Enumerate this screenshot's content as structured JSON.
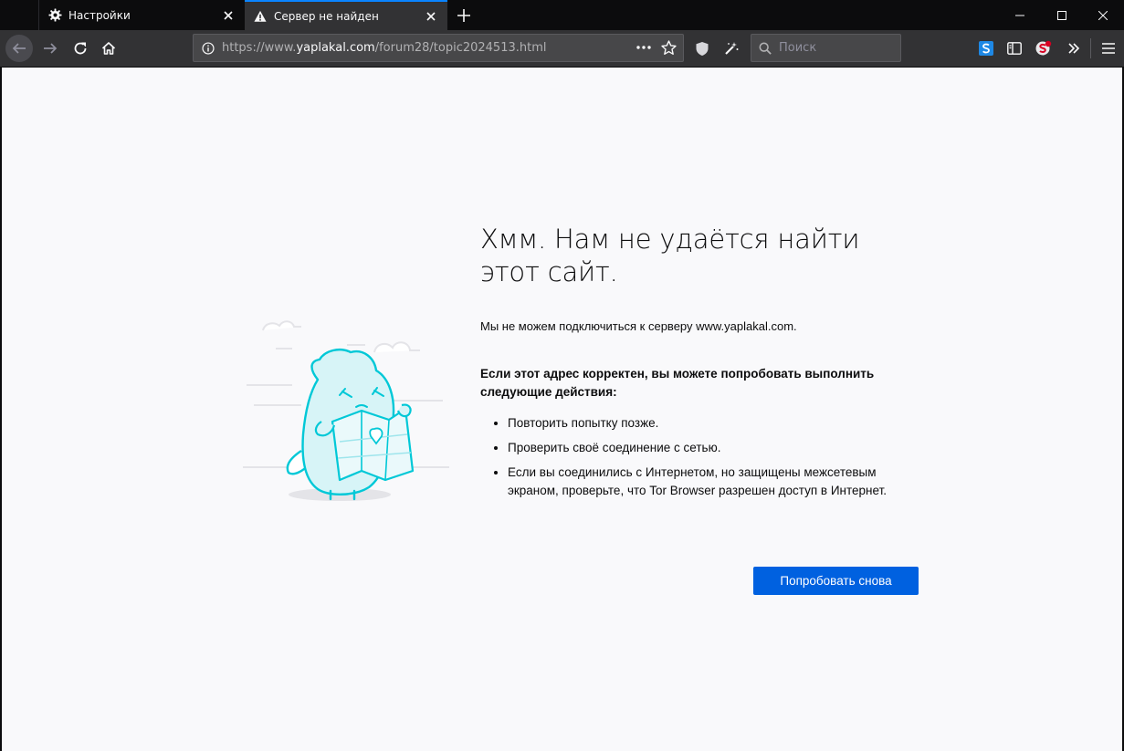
{
  "colors": {
    "accent": "#0a84ff",
    "button": "#0061e0",
    "toolbar": "#323234",
    "page_bg": "#f9f9fb",
    "illustration": "#00c8d7"
  },
  "tabs": [
    {
      "title": "Настройки",
      "icon": "gear-icon"
    },
    {
      "title": "Сервер не найден",
      "icon": "warning-icon"
    }
  ],
  "navbar": {
    "url_prefix": "https://www.",
    "url_domain": "yaplakal.com",
    "url_path": "/forum28/topic2024513.html",
    "search_placeholder": "Поиск"
  },
  "error": {
    "title": "Хмм. Нам не удаётся найти этот сайт.",
    "description": "Мы не можем подключиться к серверу www.yaplakal.com.",
    "advice_heading": "Если этот адрес корректен, вы можете попробовать выполнить следующие действия:",
    "advice_items": [
      "Повторить попытку позже.",
      "Проверить своё соединение с сетью.",
      "Если вы соединились с Интернетом, но защищены межсетевым экраном, проверьте, что Tor Browser разрешен доступ в Интернет."
    ],
    "try_again_label": "Попробовать снова"
  }
}
